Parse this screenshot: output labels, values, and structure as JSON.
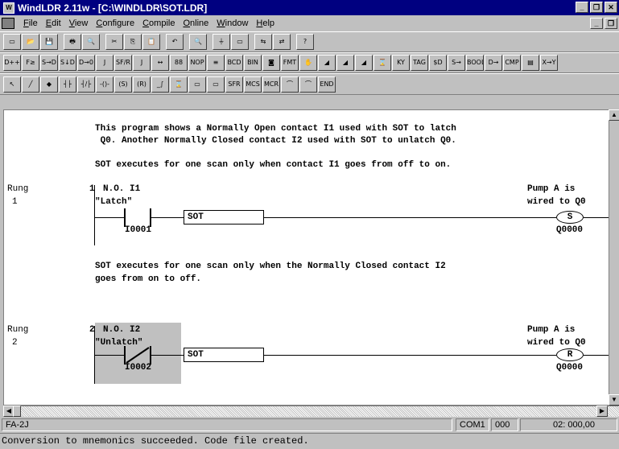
{
  "window": {
    "title": "WindLDR 2.11w - [C:\\WINDLDR\\SOT.LDR]"
  },
  "menu": [
    "File",
    "Edit",
    "View",
    "Configure",
    "Compile",
    "Online",
    "Window",
    "Help"
  ],
  "toolbar1": [
    "▭",
    "📂",
    "💾",
    "🖶",
    "🔍",
    "✂",
    "⎘",
    "📋",
    "↶",
    "🔍",
    "⏚",
    "▭",
    "⇆",
    "⇄",
    "?"
  ],
  "toolbar2": [
    "D++",
    "F≥",
    "S→D",
    "S↓D",
    "D→0",
    "J",
    "SF/R",
    "J",
    "↔",
    "88",
    "NOP",
    "≡",
    "BCD",
    "BIN",
    "◙",
    "FMT",
    "✋",
    "◢",
    "◢",
    "◢",
    "⌛",
    "KY",
    "TAG",
    "$D",
    "S→",
    "BOOL",
    "D→",
    "CMP",
    "▤",
    "X→Y"
  ],
  "toolbar3": [
    "↖",
    "╱",
    "◆",
    "┤├",
    "┤/├",
    "-()-",
    "(S)",
    "(R)",
    "_∫",
    "⌛",
    "▭",
    "▭",
    "SFR",
    "MCS",
    "MCR",
    "⌒",
    "⌒",
    "END"
  ],
  "program": {
    "comment1_line1": "This program shows a Normally Open contact I1 used with SOT to latch",
    "comment1_line2": " Q0. Another Normally Closed contact I2 used with SOT to unlatch Q0.",
    "comment2": "SOT executes for one scan only when contact I1 goes from off to on.",
    "rung1": {
      "rung_label": "Rung",
      "rung_number": "1",
      "rung_col_number": "1",
      "contact_type": "N.O. I1",
      "contact_tag": "\"Latch\"",
      "contact_addr": "I0001",
      "func_label": "SOT",
      "coil_comment1": "Pump A is",
      "coil_comment2": "wired to Q0",
      "coil_letter": "S",
      "coil_addr": "Q0000"
    },
    "comment3_line1": "SOT executes for one scan only when the Normally Closed contact I2",
    "comment3_line2": "goes from on to off.",
    "rung2": {
      "rung_label": "Rung",
      "rung_number": "2",
      "rung_col_number": "2",
      "contact_type": "N.O. I2",
      "contact_tag": "\"Unlatch\"",
      "contact_addr": "I0002",
      "func_label": "SOT",
      "coil_comment1": "Pump A is",
      "coil_comment2": "wired to Q0",
      "coil_letter": "R",
      "coil_addr": "Q0000"
    }
  },
  "status": {
    "plc_type": "FA-2J",
    "port": "COM1",
    "station": "000",
    "cursor": "02: 000,00"
  },
  "message": "Conversion to mnemonics succeeded. Code file created.",
  "colors": {
    "title_bg": "#000080",
    "selection_bg": "#c0c0c0"
  }
}
